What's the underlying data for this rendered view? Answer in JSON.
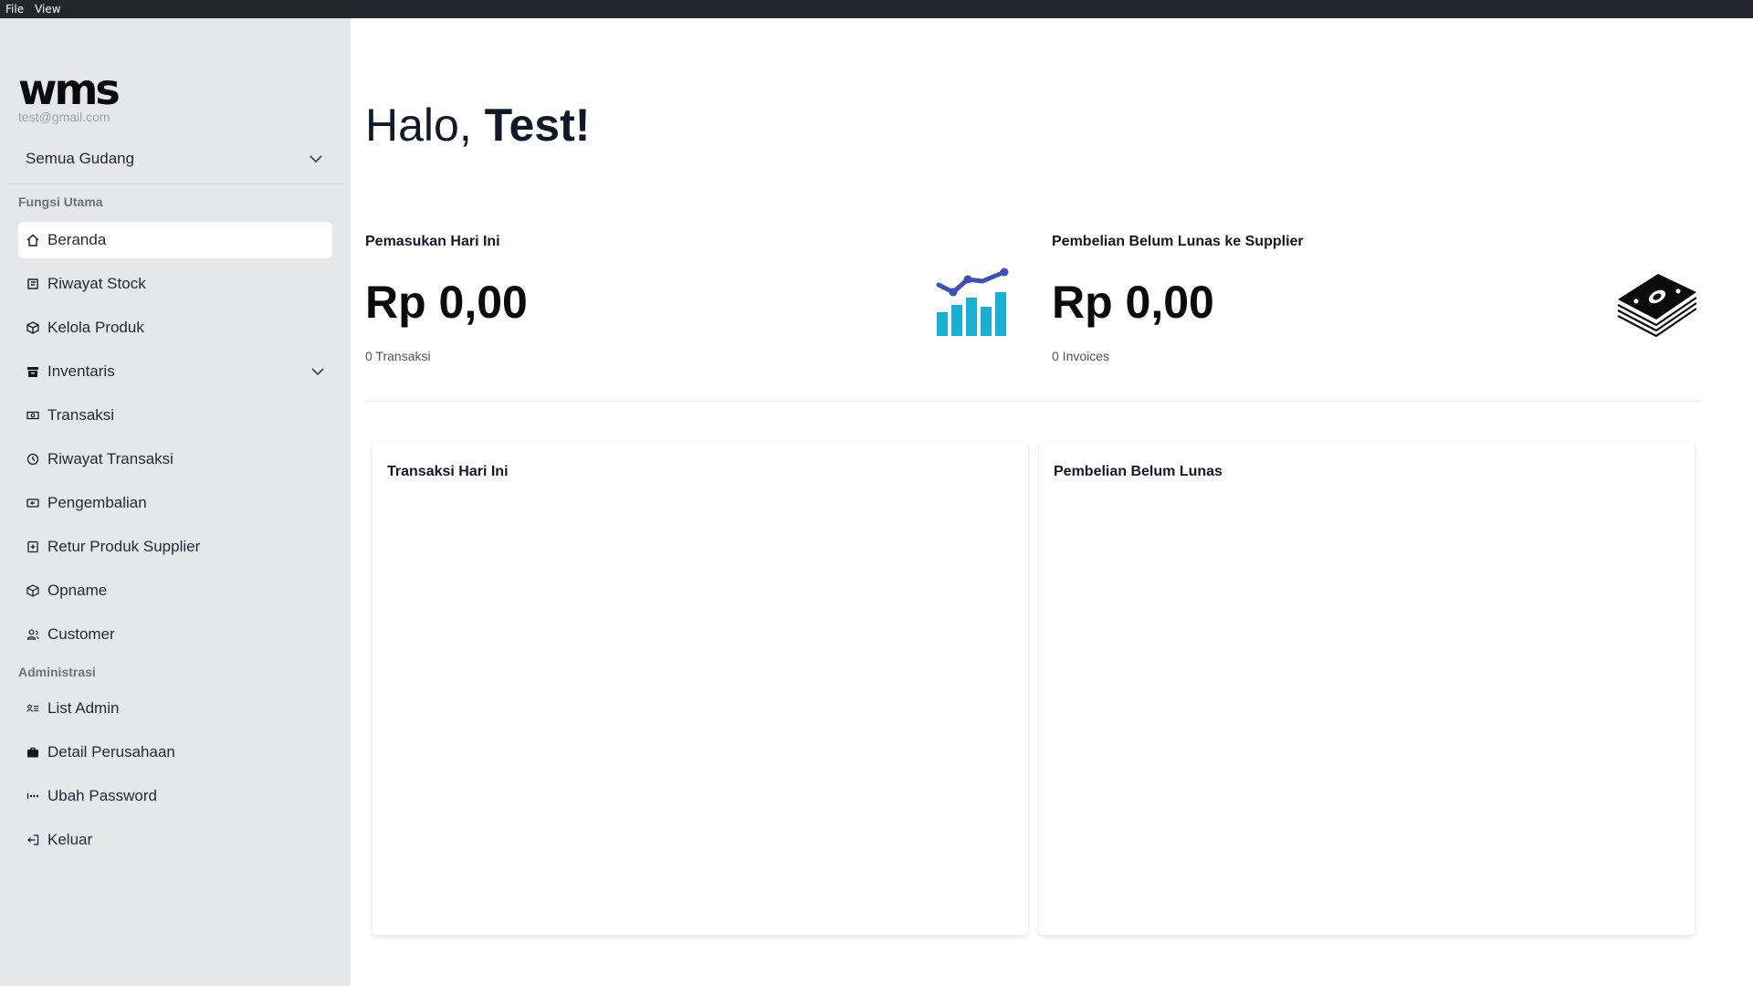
{
  "menubar": {
    "file": "File",
    "view": "View"
  },
  "sidebar": {
    "logo_text": "wms",
    "email": "test@gmail.com",
    "warehouse_select": "Semua Gudang",
    "section_main": "Fungsi Utama",
    "section_admin": "Administrasi",
    "main_items": [
      {
        "label": "Beranda",
        "icon": "home-icon"
      },
      {
        "label": "Riwayat Stock",
        "icon": "stock-history-icon"
      },
      {
        "label": "Kelola Produk",
        "icon": "box-icon"
      },
      {
        "label": "Inventaris",
        "icon": "archive-icon"
      },
      {
        "label": "Transaksi",
        "icon": "money-icon"
      },
      {
        "label": "Riwayat Transaksi",
        "icon": "history-icon"
      },
      {
        "label": "Pengembalian",
        "icon": "return-icon"
      },
      {
        "label": "Retur Produk Supplier",
        "icon": "supplier-return-icon"
      },
      {
        "label": "Opname",
        "icon": "cube-icon"
      },
      {
        "label": "Customer",
        "icon": "users-icon"
      }
    ],
    "admin_items": [
      {
        "label": "List Admin",
        "icon": "admin-list-icon"
      },
      {
        "label": "Detail Perusahaan",
        "icon": "briefcase-icon"
      },
      {
        "label": "Ubah Password",
        "icon": "password-icon"
      },
      {
        "label": "Keluar",
        "icon": "logout-icon"
      }
    ]
  },
  "main": {
    "greeting_prefix": "Halo, ",
    "greeting_name": "Test!",
    "stats": [
      {
        "label": "Pemasukan Hari Ini",
        "value": "Rp 0,00",
        "sub": "0 Transaksi",
        "icon": "chart-growth-icon"
      },
      {
        "label": "Pembelian Belum Lunas ke Supplier",
        "value": "Rp 0,00",
        "sub": "0 Invoices",
        "icon": "cash-stack-icon"
      }
    ],
    "cards": [
      {
        "title": "Transaksi Hari Ini"
      },
      {
        "title": "Pembelian Belum Lunas"
      }
    ]
  },
  "colors": {
    "sidebar_bg": "#e5e7eb",
    "menubar_bg": "#23262b",
    "chart_teal": "#17b2d2",
    "chart_line": "#3d52b5"
  }
}
